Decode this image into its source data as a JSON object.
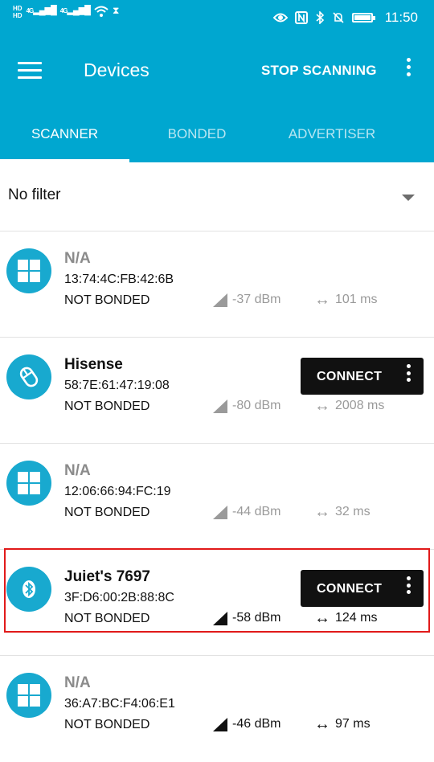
{
  "status_bar": {
    "hd1": "HD",
    "hd2": "HD",
    "net1": "4G",
    "net2": "4G",
    "time": "11:50"
  },
  "app_bar": {
    "title": "Devices",
    "stop_scanning": "STOP SCANNING"
  },
  "tabs": [
    {
      "label": "SCANNER",
      "selected": true
    },
    {
      "label": "BONDED",
      "selected": false
    },
    {
      "label": "ADVERTISER",
      "selected": false
    }
  ],
  "filter": {
    "label": "No filter"
  },
  "devices": [
    {
      "name": "N/A",
      "mac": "13:74:4C:FB:42:6B",
      "bond": "NOT BONDED",
      "rssi": "-37 dBm",
      "interval": "101 ms",
      "icon": "windows-icon",
      "connect": null
    },
    {
      "name": "Hisense",
      "mac": "58:7E:61:47:19:08",
      "bond": "NOT BONDED",
      "rssi": "-80 dBm",
      "interval": "2008 ms",
      "icon": "mouse-icon",
      "connect": "CONNECT"
    },
    {
      "name": "N/A",
      "mac": "12:06:66:94:FC:19",
      "bond": "NOT BONDED",
      "rssi": "-44 dBm",
      "interval": "32 ms",
      "icon": "windows-icon",
      "connect": null
    },
    {
      "name": "Juiet's 7697",
      "mac": "3F:D6:00:2B:88:8C",
      "bond": "NOT BONDED",
      "rssi": "-58 dBm",
      "interval": "124 ms",
      "icon": "bluetooth-icon",
      "connect": "CONNECT"
    },
    {
      "name": "N/A",
      "mac": "36:A7:BC:F4:06:E1",
      "bond": "NOT BONDED",
      "rssi": "-46 dBm",
      "interval": "97 ms",
      "icon": "windows-icon",
      "connect": null
    }
  ],
  "colors": {
    "primary": "#00a7d0",
    "avatar": "#18a9cf",
    "connect_bg": "#111111",
    "highlight": "#e11a1a"
  }
}
